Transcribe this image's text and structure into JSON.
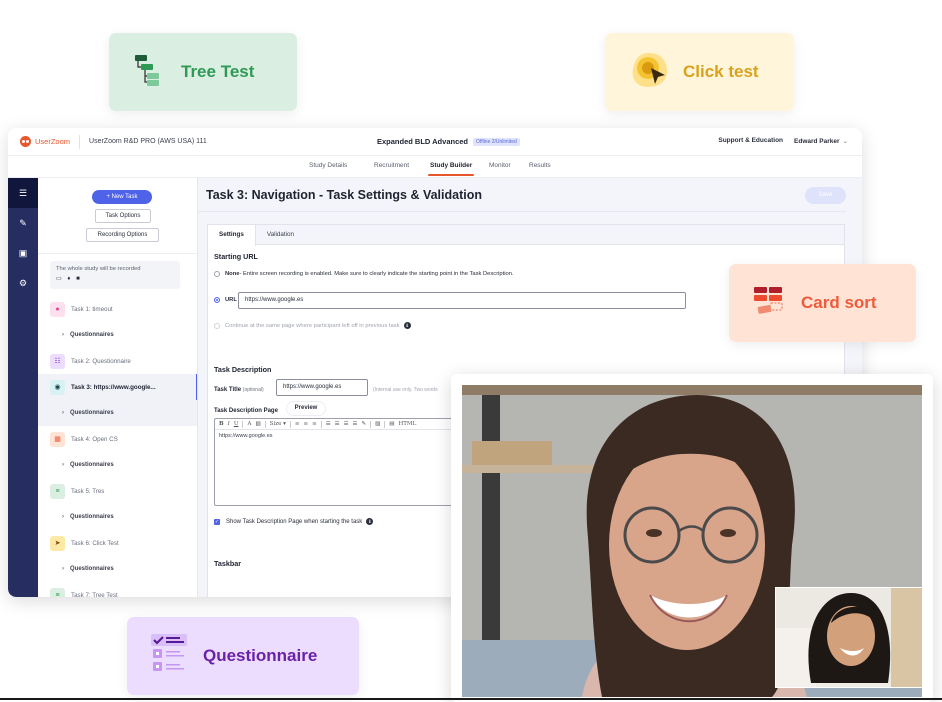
{
  "features": {
    "tree_test": {
      "label": "Tree Test",
      "icon": "tree-test-icon"
    },
    "click_test": {
      "label": "Click test",
      "icon": "click-test-icon"
    },
    "card_sort": {
      "label": "Card sort",
      "icon": "card-sort-icon"
    },
    "questionnaire": {
      "label": "Questionnaire",
      "icon": "questionnaire-icon"
    }
  },
  "app": {
    "brand": "UserZoom",
    "org": "UserZoom R&D PRO (AWS USA) 111",
    "study_title": "Expanded BLD Advanced",
    "study_badge": "Offline 2/Unlimited",
    "support_link": "Support & Education",
    "user_name": "Edward Parker",
    "user_caret": "⌄",
    "nav": [
      {
        "label": "Study Details",
        "active": false
      },
      {
        "label": "Recruitment",
        "active": false
      },
      {
        "label": "Study Builder",
        "active": true
      },
      {
        "label": "Monitor",
        "active": false
      },
      {
        "label": "Results",
        "active": false
      }
    ],
    "rail": [
      {
        "icon": "list-icon",
        "glyph": "☰",
        "active": true
      },
      {
        "icon": "brush-icon",
        "glyph": "✎",
        "active": false
      },
      {
        "icon": "preview-icon",
        "glyph": "▣",
        "active": false
      },
      {
        "icon": "gear-icon",
        "glyph": "⚙",
        "active": false
      }
    ],
    "task_panel": {
      "new_task": "+ New Task",
      "task_options": "Task Options",
      "recording_options": "Recording Options",
      "record_note": "The whole study will be recorded",
      "record_icons": "▭ ♦ ■",
      "tasks": [
        {
          "label": "Task 1: timeout",
          "type": "timeout",
          "selected": false
        },
        {
          "label": "Task 2: Questionnaire",
          "type": "questionnaire",
          "selected": false
        },
        {
          "label": "Task 3: https://www.google...",
          "type": "navigation",
          "selected": true
        },
        {
          "label": "Task 4: Open CS",
          "type": "card-sort",
          "selected": false
        },
        {
          "label": "Task 5: Tres",
          "type": "tree-test",
          "selected": false
        },
        {
          "label": "Task 6: Click Test",
          "type": "click-test",
          "selected": false
        },
        {
          "label": "Task 7: Tree Test",
          "type": "tree-test",
          "selected": false
        }
      ],
      "sub_label": "Questionnaires",
      "caret": "›"
    },
    "main": {
      "title": "Task 3: Navigation - Task Settings & Validation",
      "save": "Save",
      "tabs": [
        {
          "label": "Settings",
          "active": true
        },
        {
          "label": "Validation",
          "active": false
        }
      ],
      "starting_url": {
        "heading": "Starting URL",
        "option_none_bold": "None",
        "option_none_text": " - Entire screen recording is enabled. Make sure to clearly indicate the starting point in the Task Description.",
        "option_url": "URL",
        "url_value": "https://www.google.es",
        "option_continue": "Continue at the same page where participant left off in previous task",
        "selected": "url"
      },
      "task_description": {
        "heading": "Task Description",
        "title_label": "Task Title",
        "title_optional": "(optional)",
        "title_value": "https://www.google.es",
        "title_hint": "(Internal use only. Two words",
        "page_label": "Task Description Page",
        "preview": "Preview",
        "toolbar": [
          "B",
          "I",
          "U",
          "A",
          "▧",
          "Size ▾",
          "≡",
          "≡",
          "≡",
          "☰",
          "☰",
          "☰",
          "☰",
          "✎",
          "▨",
          "▤",
          "HTML"
        ],
        "editor_text": "https://www.google.es",
        "show_page_checkbox": "Show Task Description Page when starting the task",
        "show_page_checked": true
      },
      "taskbar_heading": "Taskbar"
    }
  },
  "colors": {
    "brand_orange": "#e8562e",
    "primary_blue": "#4f63e8",
    "rail_navy": "#262d61",
    "tree_green": "#2e9a55",
    "click_yellow": "#d9a21c",
    "card_red": "#ee5a3c",
    "quest_purple": "#6a22a9"
  },
  "video": {
    "description": "Video call with participant; picture-in-picture of second participant"
  }
}
